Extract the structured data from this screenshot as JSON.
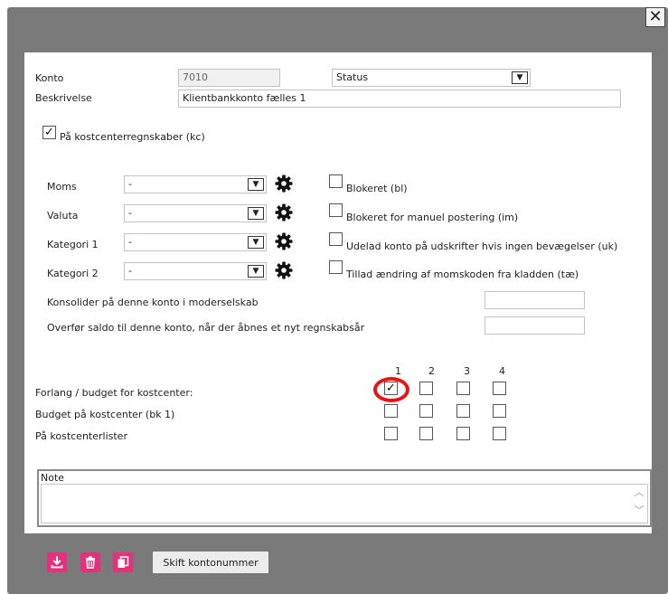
{
  "form": {
    "konto_label": "Konto",
    "konto_value": "7010",
    "status_value": "Status",
    "beskrivelse_label": "Beskrivelse",
    "beskrivelse_value": "Klientbankkonto fælles 1",
    "kostcenter_label": "På kostcenterregnskaber (kc)"
  },
  "dropdowns": [
    {
      "label": "Moms",
      "value": "-"
    },
    {
      "label": "Valuta",
      "value": "-"
    },
    {
      "label": "Kategori 1",
      "value": "-"
    },
    {
      "label": "Kategori 2",
      "value": "-"
    }
  ],
  "checkboxes": [
    {
      "label": "Blokeret (bl)",
      "checked": false
    },
    {
      "label": "Blokeret for manuel postering (im)",
      "checked": false
    },
    {
      "label": "Udelad konto på udskrifter hvis ingen bevægelser (uk)",
      "checked": false
    },
    {
      "label": "Tillad ændring af momskoden fra kladden (tæ)",
      "checked": false
    }
  ],
  "konsolider_label": "Konsolider på denne konto i moderselskab",
  "overfoer_label": "Overfør saldo til denne konto, når der åbnes et nyt regnskabsår",
  "cost_grid": {
    "columns": [
      "1",
      "2",
      "3",
      "4"
    ],
    "rows": [
      {
        "label": "Forlang / budget for kostcenter:",
        "checked": [
          true,
          false,
          false,
          false
        ]
      },
      {
        "label": "Budget på kostcenter (bk 1)",
        "checked": [
          false,
          false,
          false,
          false
        ]
      },
      {
        "label": "På kostcenterlister",
        "checked": [
          false,
          false,
          false,
          false
        ]
      }
    ]
  },
  "note_label": "Note",
  "footer": {
    "skift_label": "Skift kontonummer"
  },
  "icons": {
    "close": "close-icon",
    "gear": "gear-icon",
    "download": "download-icon",
    "delete": "trash-icon",
    "copy": "copy-icon"
  },
  "colors": {
    "overlay": "#7a7a7a",
    "accent": "#e5307d",
    "highlight": "#e11111"
  }
}
